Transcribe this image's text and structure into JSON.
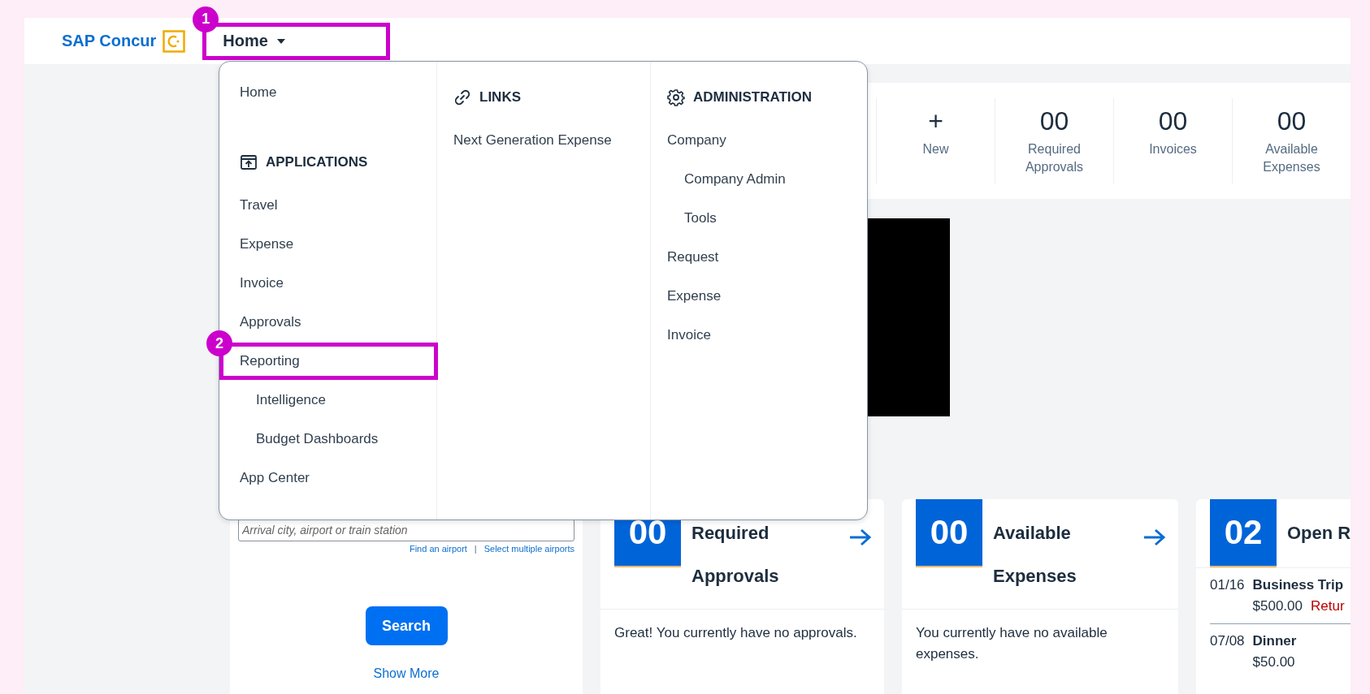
{
  "header": {
    "logo": "SAP Concur",
    "nav": {
      "label": "Home",
      "expanded": true,
      "callout": "1"
    }
  },
  "menu": {
    "columns": [
      {
        "lead": "Home",
        "heading": "APPLICATIONS",
        "items": [
          {
            "label": "Travel"
          },
          {
            "label": "Expense"
          },
          {
            "label": "Invoice"
          },
          {
            "label": "Approvals"
          },
          {
            "label": "Reporting",
            "callout": "2",
            "children": [
              {
                "label": "Intelligence"
              },
              {
                "label": "Budget Dashboards"
              }
            ]
          },
          {
            "label": "App Center"
          }
        ]
      },
      {
        "heading": "LINKS",
        "items": [
          {
            "label": "Next Generation Expense"
          }
        ]
      },
      {
        "heading": "ADMINISTRATION",
        "items": [
          {
            "label": "Company",
            "children": [
              {
                "label": "Company Admin"
              },
              {
                "label": "Tools"
              }
            ]
          },
          {
            "label": "Request"
          },
          {
            "label": "Expense"
          },
          {
            "label": "Invoice"
          }
        ]
      }
    ]
  },
  "stats": [
    {
      "value": "+",
      "label": "New"
    },
    {
      "value": "00",
      "label": "Required Approvals"
    },
    {
      "value": "00",
      "label": "Invoices"
    },
    {
      "value": "00",
      "label": "Available Expenses"
    }
  ],
  "trip_search": {
    "placeholder": "Arrival city, airport or train station",
    "links": [
      "Find an airport",
      "Select multiple airports"
    ],
    "separator": "|",
    "button": "Search",
    "more": "Show More"
  },
  "cards": [
    {
      "kind": "message",
      "count": "00",
      "title": "Required Approvals",
      "message": "Great! You currently have no approvals."
    },
    {
      "kind": "message",
      "count": "00",
      "title": "Available Expenses",
      "message": "You currently have no available expenses."
    },
    {
      "kind": "list",
      "count": "02",
      "title": "Open R",
      "rows": [
        {
          "date": "01/16",
          "name": "Business Trip",
          "amount": "$500.00",
          "status": "Retur"
        },
        {
          "date": "07/08",
          "name": "Dinner",
          "amount": "$50.00"
        }
      ]
    }
  ]
}
